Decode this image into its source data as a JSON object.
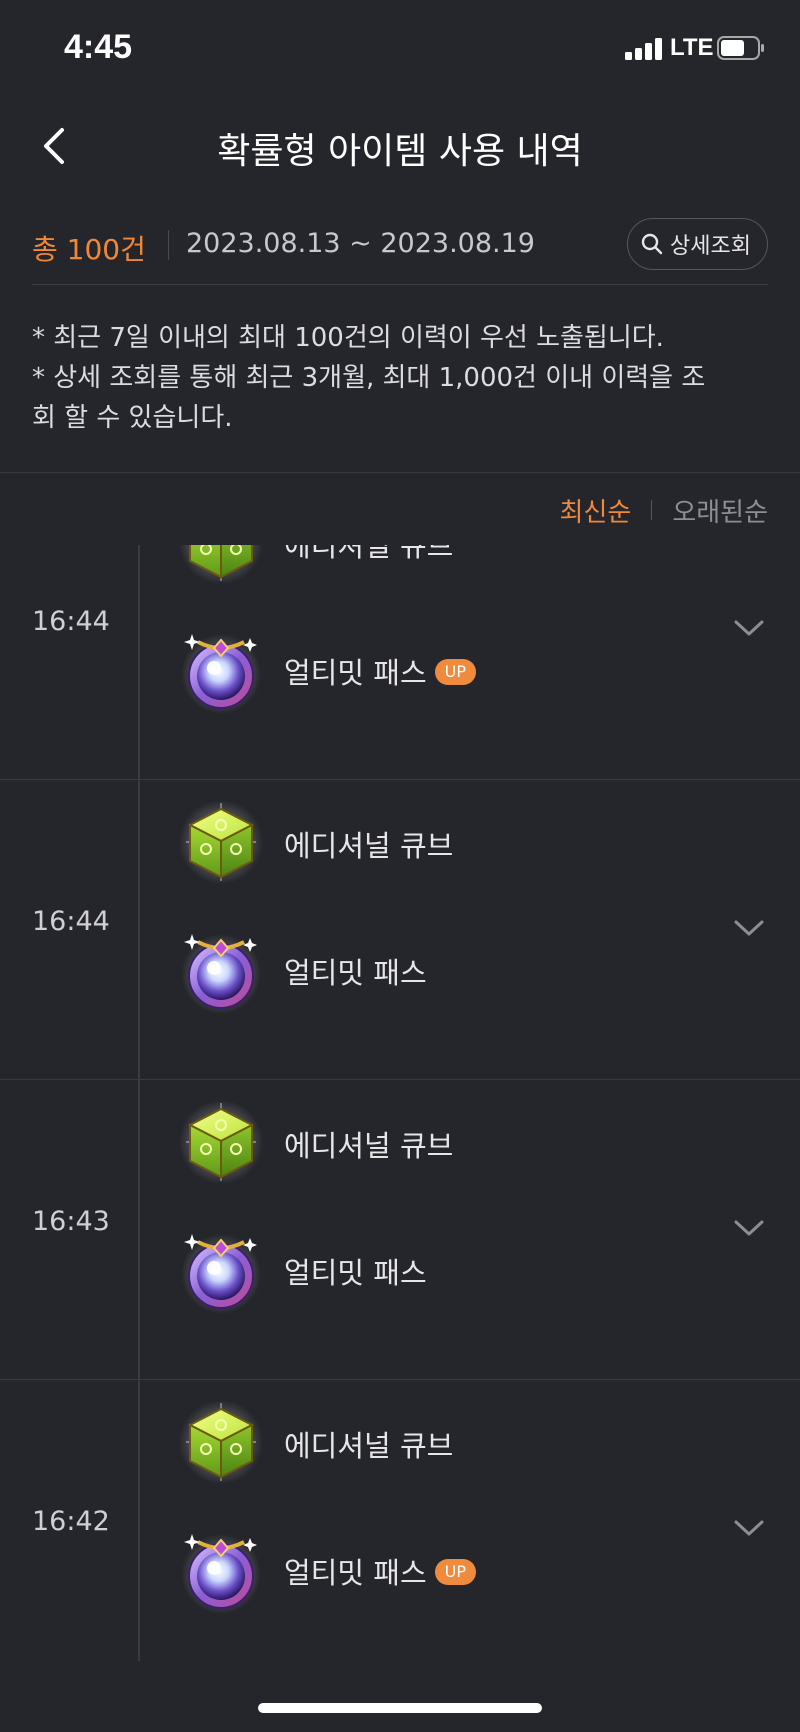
{
  "status_bar": {
    "time": "4:45",
    "network": "LTE",
    "signal_bars": 4,
    "battery_level": 0.65
  },
  "header": {
    "title": "확률형 아이템 사용 내역",
    "back_icon": "chevron-left-icon"
  },
  "summary": {
    "total": "총 100건",
    "date_range": "2023.08.13 ~ 2023.08.19",
    "detail_button_label": "상세조회",
    "detail_button_icon": "search-icon"
  },
  "notice": {
    "line1": "* 최근 7일 이내의 최대 100건의 이력이 우선 노출됩니다.",
    "line2": "* 상세 조회를 통해 최근 3개월, 최대 1,000건 이내 이력을 조",
    "line3": "회 할 수 있습니다."
  },
  "sort": {
    "newest": "최신순",
    "oldest": "오래된순",
    "active": "newest"
  },
  "entries": [
    {
      "time": "16:44",
      "items": [
        {
          "name": "에디셔널 큐브",
          "icon": "additional-cube-icon",
          "badge": ""
        },
        {
          "name": "얼티밋 패스",
          "icon": "ultimate-pass-icon",
          "badge": "UP"
        }
      ]
    },
    {
      "time": "16:44",
      "items": [
        {
          "name": "에디셔널 큐브",
          "icon": "additional-cube-icon",
          "badge": ""
        },
        {
          "name": "얼티밋 패스",
          "icon": "ultimate-pass-icon",
          "badge": ""
        }
      ]
    },
    {
      "time": "16:43",
      "items": [
        {
          "name": "에디셔널 큐브",
          "icon": "additional-cube-icon",
          "badge": ""
        },
        {
          "name": "얼티밋 패스",
          "icon": "ultimate-pass-icon",
          "badge": ""
        }
      ]
    },
    {
      "time": "16:42",
      "items": [
        {
          "name": "에디셔널 큐브",
          "icon": "additional-cube-icon",
          "badge": ""
        },
        {
          "name": "얼티밋 패스",
          "icon": "ultimate-pass-icon",
          "badge": "UP"
        }
      ]
    }
  ],
  "colors": {
    "background": "#25262b",
    "accent": "#f0883a",
    "divider": "#3a3b42",
    "text_primary": "#e6e6e8",
    "text_muted": "#8d8e95"
  }
}
